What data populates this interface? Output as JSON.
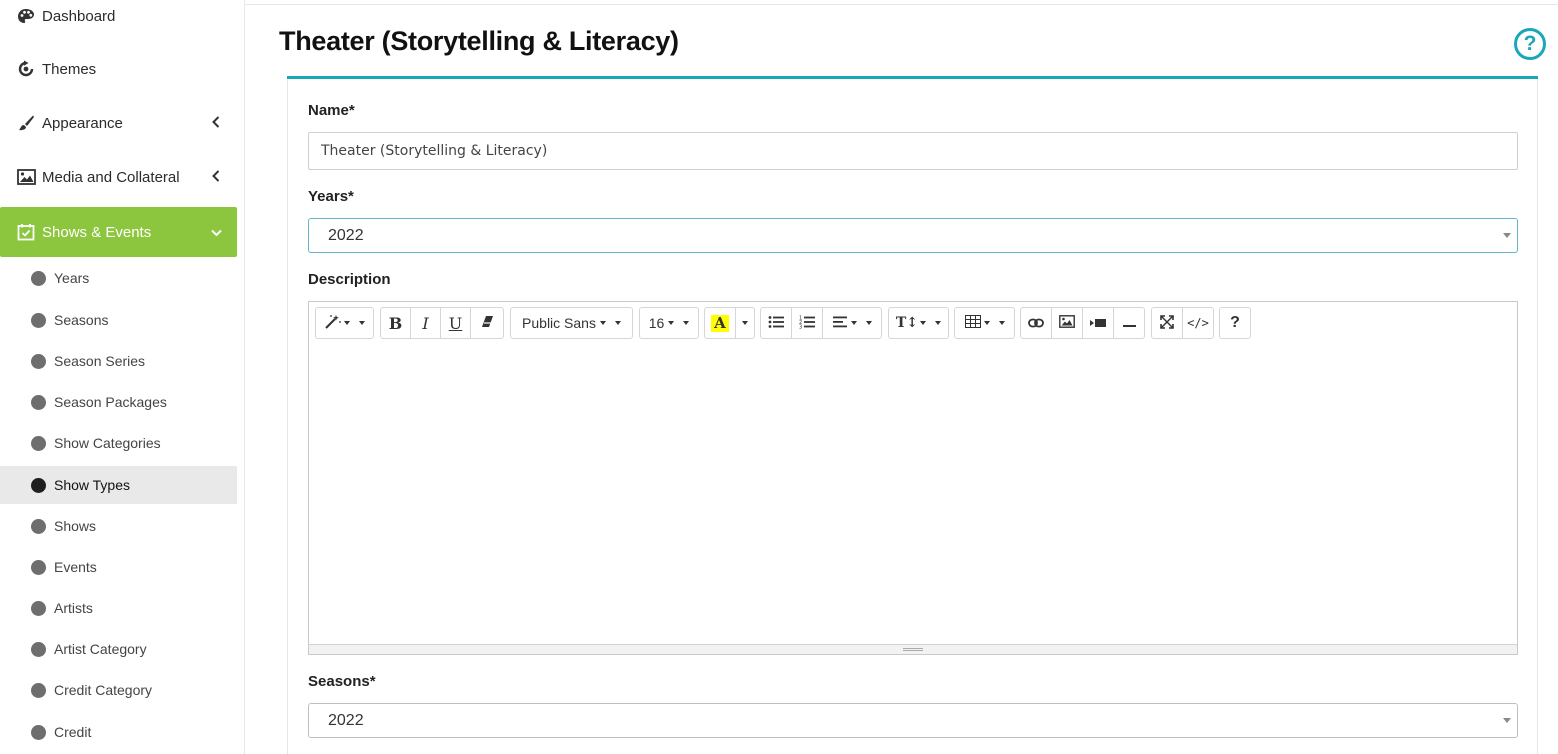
{
  "sidebar": {
    "items": [
      {
        "label": "Dashboard",
        "icon": "palette-icon"
      },
      {
        "label": "Themes",
        "icon": "refresh-icon"
      },
      {
        "label": "Appearance",
        "icon": "brush-icon",
        "chevron": "‹"
      },
      {
        "label": "Media and Collateral",
        "icon": "image-icon",
        "chevron": "‹"
      },
      {
        "label": "Shows & Events",
        "icon": "calendar-check-icon",
        "chevron": "⌄",
        "active": true
      }
    ],
    "subitems": [
      {
        "label": "Years"
      },
      {
        "label": "Seasons"
      },
      {
        "label": "Season Series"
      },
      {
        "label": "Season Packages"
      },
      {
        "label": "Show Categories"
      },
      {
        "label": "Show Types",
        "selected": true
      },
      {
        "label": "Shows"
      },
      {
        "label": "Events"
      },
      {
        "label": "Artists"
      },
      {
        "label": "Artist Category"
      },
      {
        "label": "Credit Category"
      },
      {
        "label": "Credit"
      }
    ],
    "accent_color": "#8cc63f"
  },
  "main": {
    "title": "Theater (Storytelling & Literacy)",
    "help_label": "?",
    "accent_color": "#1ca7b8",
    "name": {
      "label": "Name*",
      "value": "Theater (Storytelling & Literacy)"
    },
    "years": {
      "label": "Years*",
      "value": "2022"
    },
    "description": {
      "label": "Description",
      "toolbar": {
        "font_family": "Public Sans",
        "font_size": "16",
        "bold": "B",
        "italic": "I",
        "underline": "U",
        "highlight": "A",
        "text_height": "T↕",
        "code": "</>",
        "help": "?"
      }
    },
    "seasons": {
      "label": "Seasons*",
      "value": "2022"
    }
  }
}
